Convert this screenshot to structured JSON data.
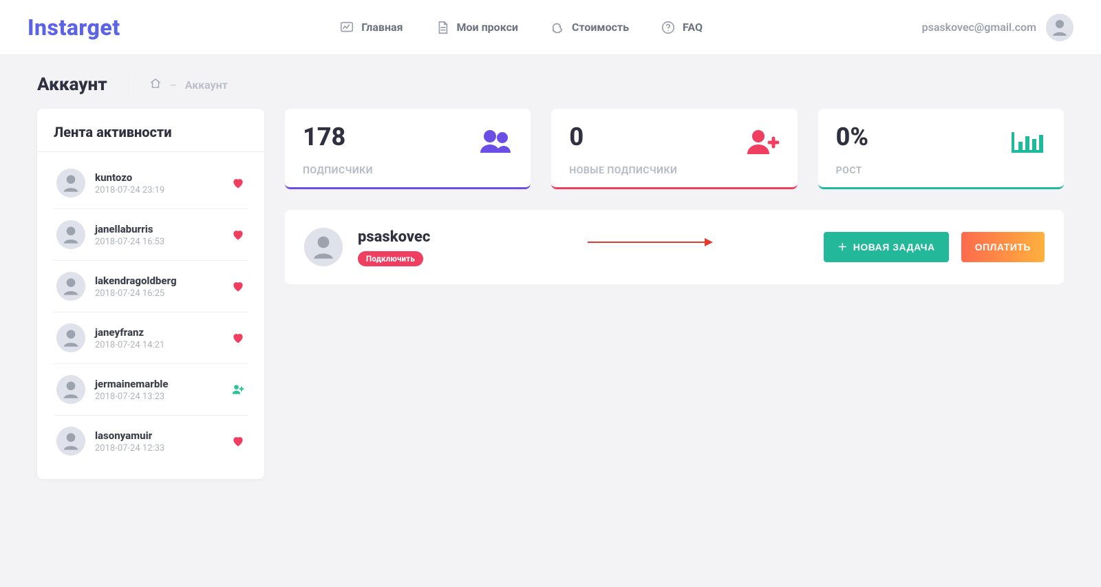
{
  "brand": "Instarget",
  "nav": {
    "home": "Главная",
    "proxies": "Мои прокси",
    "pricing": "Стоимость",
    "faq": "FAQ"
  },
  "user": {
    "email": "psaskovec@gmail.com"
  },
  "page": {
    "title": "Аккаунт",
    "breadcrumb_dash": "–",
    "breadcrumb_current": "Аккаунт"
  },
  "activity": {
    "title": "Лента активности",
    "items": [
      {
        "username": "kuntozo",
        "time": "2018-07-24 23:19",
        "type": "like"
      },
      {
        "username": "janellaburris",
        "time": "2018-07-24 16:53",
        "type": "like"
      },
      {
        "username": "lakendragoldberg",
        "time": "2018-07-24 16:25",
        "type": "like"
      },
      {
        "username": "janeyfranz",
        "time": "2018-07-24 14:21",
        "type": "like"
      },
      {
        "username": "jermainemarble",
        "time": "2018-07-24 13:23",
        "type": "follow"
      },
      {
        "username": "lasonyamuir",
        "time": "2018-07-24 12:33",
        "type": "like"
      }
    ]
  },
  "stats": {
    "followers": {
      "value": "178",
      "label": "ПОДПИСЧИКИ"
    },
    "new_followers": {
      "value": "0",
      "label": "НОВЫЕ ПОДПИСЧИКИ"
    },
    "growth": {
      "value": "0%",
      "label": "РОСТ"
    }
  },
  "account": {
    "username": "psaskovec",
    "status_chip": "Подключить",
    "new_task_label": "НОВАЯ ЗАДАЧА",
    "pay_label": "ОПЛАТИТЬ"
  },
  "colors": {
    "brand": "#5b63e6",
    "purple": "#6b4ee6",
    "pink": "#ef3e60",
    "teal": "#1fb99b"
  }
}
